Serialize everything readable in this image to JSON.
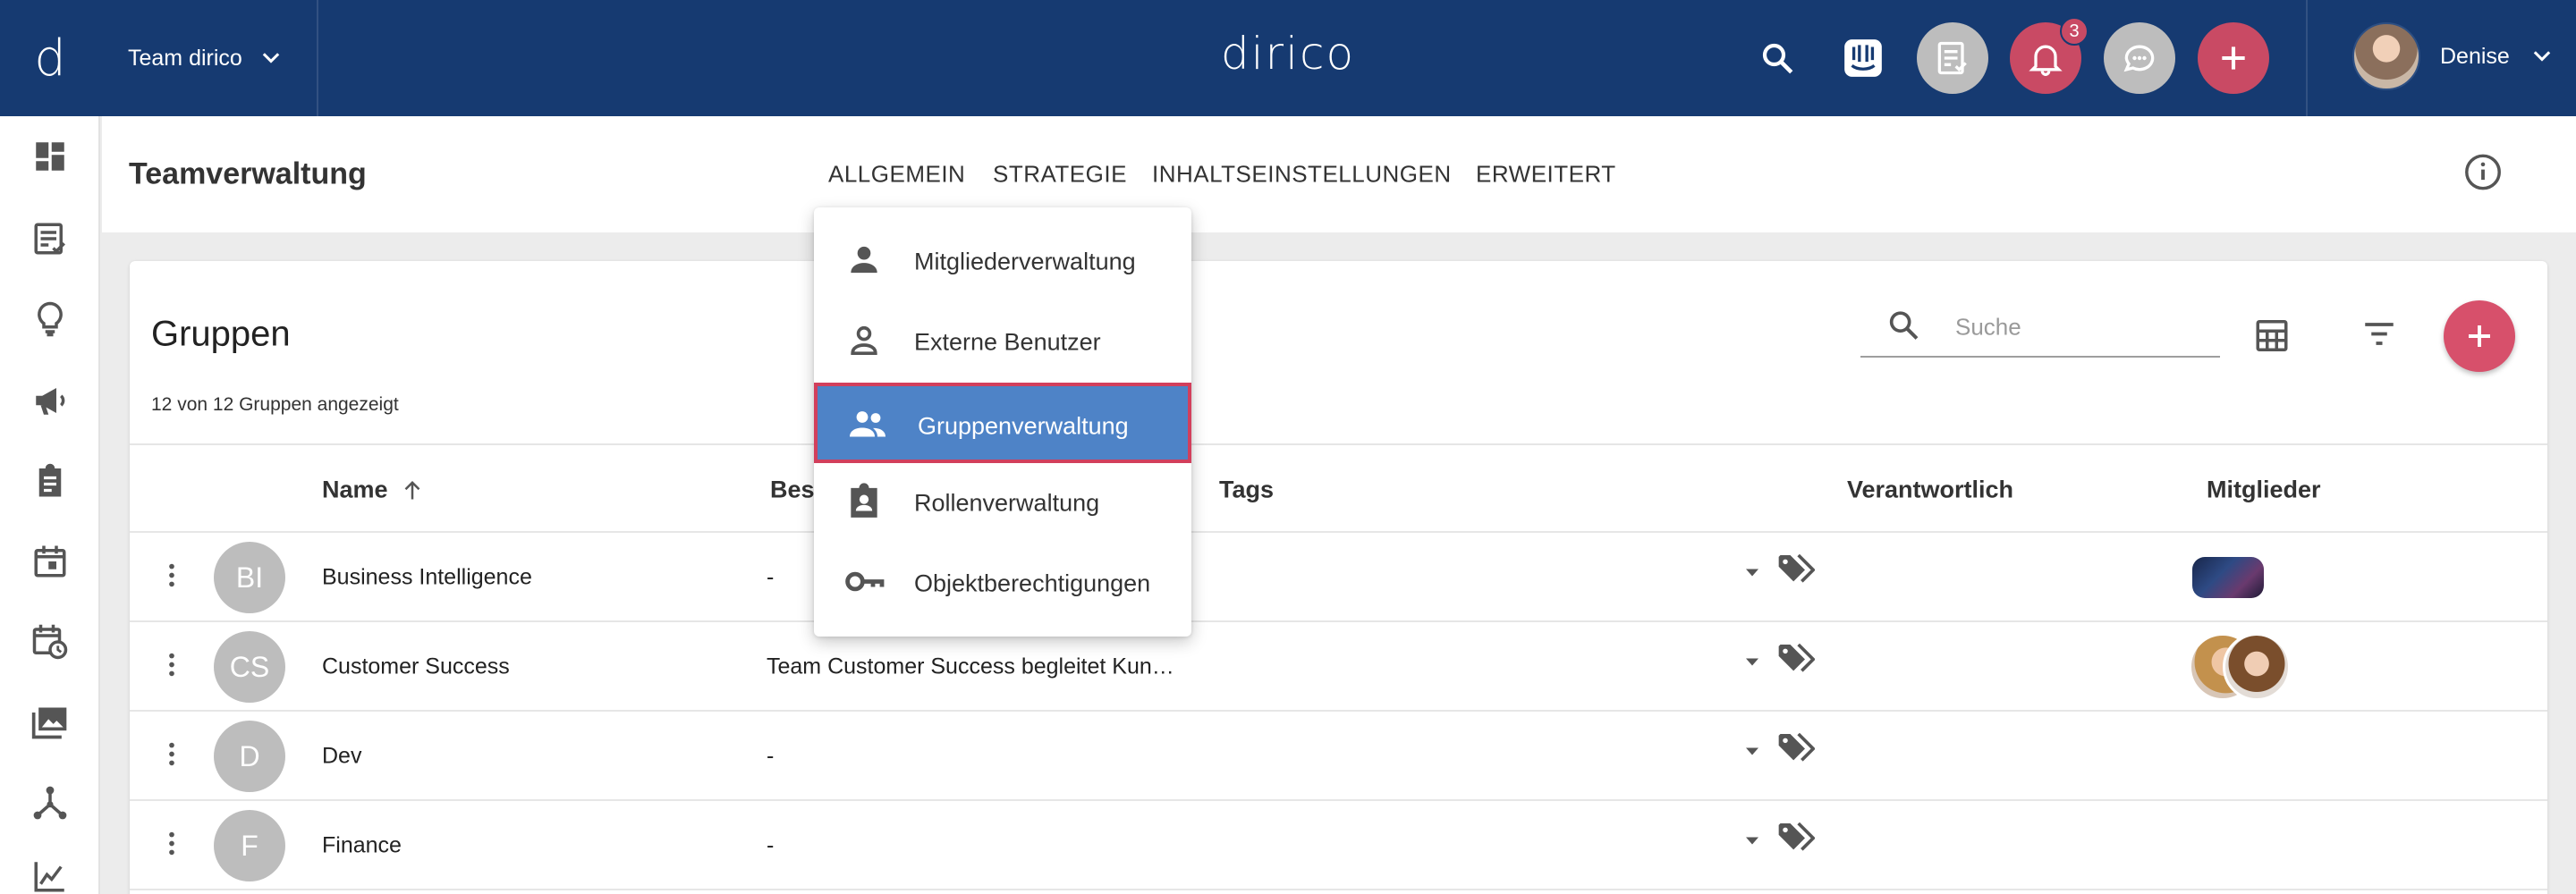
{
  "brand": "dirico",
  "topbar": {
    "team_switch_label": "Team dirico",
    "notification_count": "3",
    "user_name": "Denise",
    "colors": {
      "primary": "#163a71",
      "accent": "#c94a64"
    }
  },
  "page": {
    "title": "Teamverwaltung",
    "tabs": [
      "ALLGEMEIN",
      "STRATEGIE",
      "INHALTSEINSTELLUNGEN",
      "ERWEITERT"
    ]
  },
  "dropdown": {
    "items": [
      {
        "label": "Mitgliederverwaltung",
        "icon": "person-icon"
      },
      {
        "label": "Externe Benutzer",
        "icon": "person-outline-icon"
      },
      {
        "label": "Gruppenverwaltung",
        "icon": "group-icon",
        "active": true
      },
      {
        "label": "Rollenverwaltung",
        "icon": "badge-icon"
      },
      {
        "label": "Objektberechtigungen",
        "icon": "key-icon"
      }
    ]
  },
  "groups": {
    "title": "Gruppen",
    "count_text": "12 von 12 Gruppen angezeigt",
    "search_placeholder": "Suche",
    "columns": {
      "name": "Name",
      "description": "Bes",
      "tags": "Tags",
      "responsible": "Verantwortlich",
      "members": "Mitglieder"
    },
    "rows": [
      {
        "initials": "BI",
        "name": "Business Intelligence",
        "description": "-",
        "members": "thumbnail"
      },
      {
        "initials": "CS",
        "name": "Customer Success",
        "description": "Team Customer Success begleitet Kun…",
        "members": "two-avatars"
      },
      {
        "initials": "D",
        "name": "Dev",
        "description": "-",
        "members": ""
      },
      {
        "initials": "F",
        "name": "Finance",
        "description": "-",
        "members": ""
      }
    ]
  }
}
